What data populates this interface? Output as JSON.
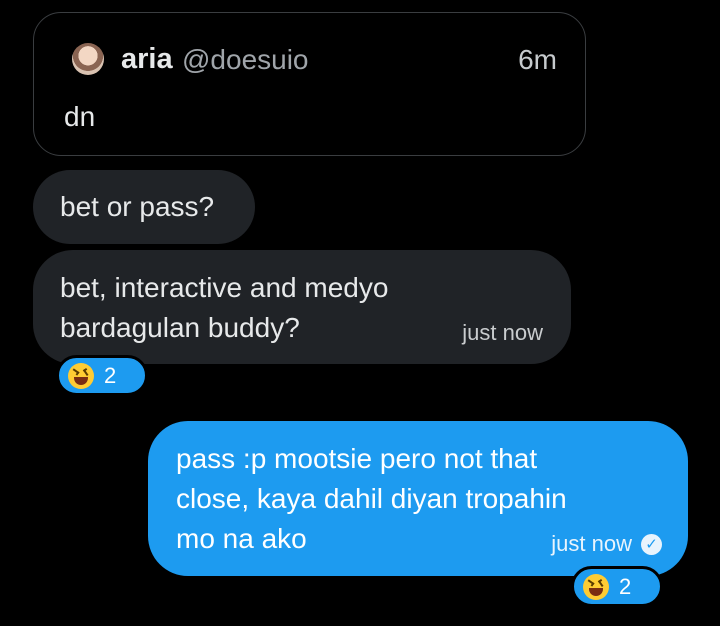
{
  "quote": {
    "name": "aria",
    "handle": "@doesuio",
    "time": "6m",
    "text": "dn"
  },
  "messages": [
    {
      "text": "bet or pass?"
    },
    {
      "text": "bet, interactive and medyo\nbardagulan buddy?",
      "time": "just now",
      "reaction": {
        "count": "2"
      }
    },
    {
      "text": "pass :p mootsie pero not that\nclose, kaya dahil diyan tropahin\nmo na ako",
      "time": "just now",
      "reaction": {
        "count": "2"
      }
    }
  ],
  "colors": {
    "sent_bubble": "#1d9bf0",
    "received_bubble": "#202327",
    "background": "#000000"
  },
  "icons": {
    "avatar": "profile-avatar",
    "reaction": "laughing-face-emoji",
    "status": "seen-check-icon"
  }
}
